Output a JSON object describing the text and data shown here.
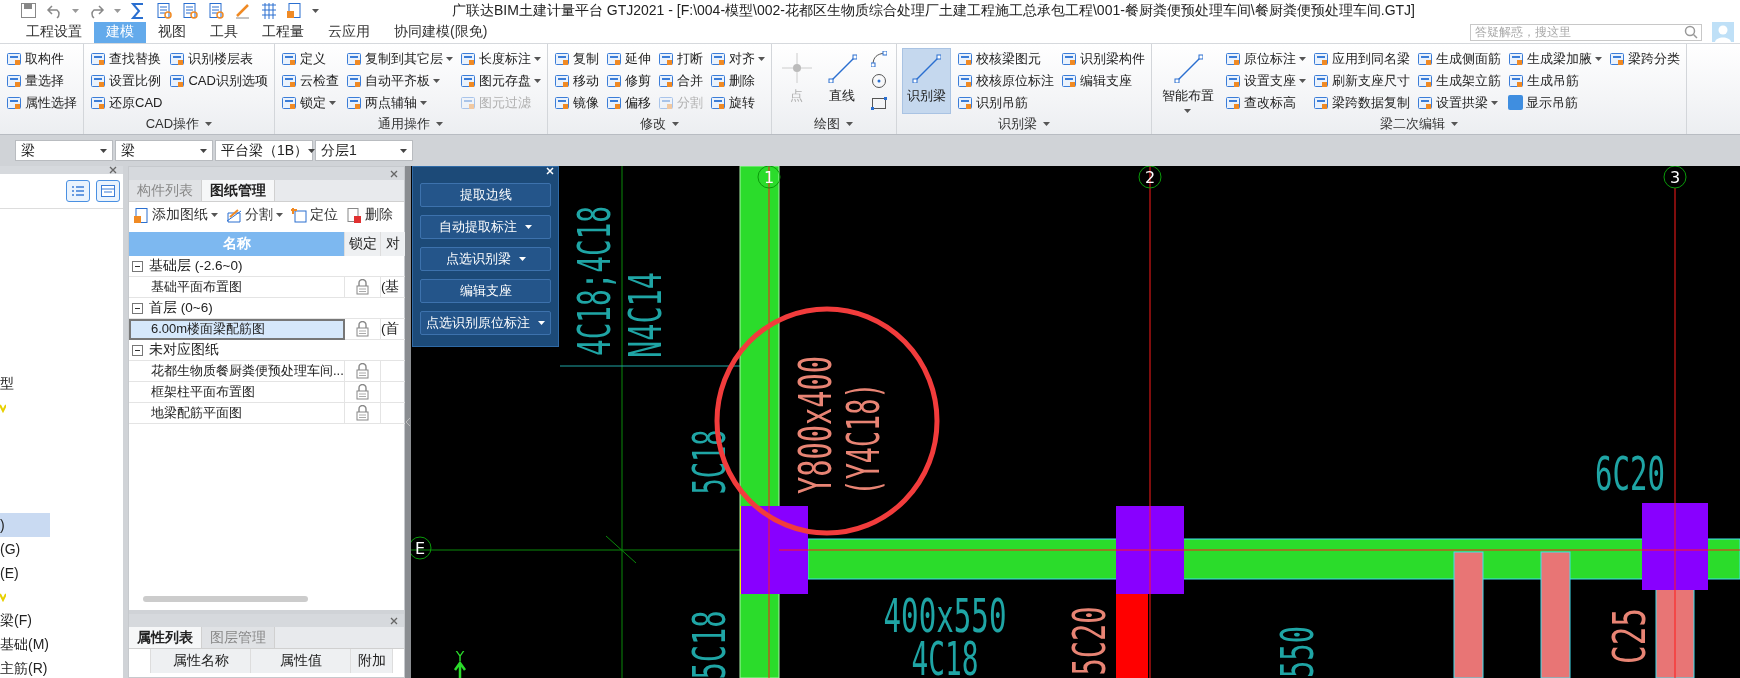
{
  "window": {
    "title": "广联达BIM土建计量平台 GTJ2021 - [F:\\004-模型\\002-花都区生物质综合处理厂土建工程施工总承包工程\\001-餐厨粪便预处理车间\\餐厨粪便预处理车间.GTJ]"
  },
  "menu_tabs": [
    {
      "label": "工程设置",
      "selected": false
    },
    {
      "label": "建模",
      "selected": true
    },
    {
      "label": "视图",
      "selected": false
    },
    {
      "label": "工具",
      "selected": false
    },
    {
      "label": "工程量",
      "selected": false
    },
    {
      "label": "云应用",
      "selected": false
    },
    {
      "label": "协同建模(限免)",
      "selected": false
    }
  ],
  "search": {
    "placeholder": "答疑解惑，搜这里"
  },
  "ribbon_groups": [
    {
      "items": [
        {
          "label": "取构件",
          "kind": "small",
          "dropdown": false,
          "disabled": false,
          "active": false
        },
        {
          "label": "量选择",
          "kind": "small",
          "dropdown": false,
          "disabled": false,
          "active": false
        },
        {
          "label": "属性选择",
          "kind": "small",
          "dropdown": false,
          "disabled": false,
          "active": false
        }
      ]
    },
    {
      "label": "CAD操作",
      "items": [
        {
          "label": "查找替换",
          "kind": "small",
          "dropdown": false,
          "disabled": false,
          "active": false
        },
        {
          "label": "设置比例",
          "kind": "small",
          "dropdown": false,
          "disabled": false,
          "active": false
        },
        {
          "label": "还原CAD",
          "kind": "small",
          "dropdown": false,
          "disabled": false,
          "active": false
        },
        {
          "label": "识别楼层表",
          "kind": "small",
          "dropdown": false,
          "disabled": false,
          "active": false
        },
        {
          "label": "CAD识别选项",
          "kind": "small",
          "dropdown": false,
          "disabled": false,
          "active": false
        }
      ]
    },
    {
      "label": "通用操作",
      "items": [
        {
          "label": "定义",
          "kind": "small",
          "dropdown": false,
          "disabled": false,
          "active": false
        },
        {
          "label": "云检查",
          "kind": "small",
          "dropdown": false,
          "disabled": false,
          "active": false
        },
        {
          "label": "锁定",
          "kind": "small",
          "dropdown": true,
          "disabled": false,
          "active": false
        },
        {
          "label": "复制到其它层",
          "kind": "small",
          "dropdown": true,
          "disabled": false,
          "active": false
        },
        {
          "label": "自动平齐板",
          "kind": "small",
          "dropdown": true,
          "disabled": false,
          "active": false
        },
        {
          "label": "两点辅轴",
          "kind": "small",
          "dropdown": true,
          "disabled": false,
          "active": false
        },
        {
          "label": "长度标注",
          "kind": "small",
          "dropdown": true,
          "disabled": false,
          "active": false
        },
        {
          "label": "图元存盘",
          "kind": "small",
          "dropdown": true,
          "disabled": false,
          "active": false
        },
        {
          "label": "图元过滤",
          "kind": "small",
          "dropdown": false,
          "disabled": true,
          "active": false
        }
      ]
    },
    {
      "label": "修改",
      "items": [
        {
          "label": "复制",
          "kind": "small",
          "dropdown": false,
          "disabled": false,
          "active": false
        },
        {
          "label": "移动",
          "kind": "small",
          "dropdown": false,
          "disabled": false,
          "active": false
        },
        {
          "label": "镜像",
          "kind": "small",
          "dropdown": false,
          "disabled": false,
          "active": false
        },
        {
          "label": "延伸",
          "kind": "small",
          "dropdown": false,
          "disabled": false,
          "active": false
        },
        {
          "label": "修剪",
          "kind": "small",
          "dropdown": false,
          "disabled": false,
          "active": false
        },
        {
          "label": "偏移",
          "kind": "small",
          "dropdown": false,
          "disabled": false,
          "active": false
        },
        {
          "label": "打断",
          "kind": "small",
          "dropdown": false,
          "disabled": false,
          "active": false
        },
        {
          "label": "合并",
          "kind": "small",
          "dropdown": false,
          "disabled": false,
          "active": false
        },
        {
          "label": "分割",
          "kind": "small",
          "dropdown": false,
          "disabled": true,
          "active": false
        },
        {
          "label": "对齐",
          "kind": "small",
          "dropdown": true,
          "disabled": false,
          "active": false
        },
        {
          "label": "删除",
          "kind": "small",
          "dropdown": false,
          "disabled": false,
          "active": false
        },
        {
          "label": "旋转",
          "kind": "small",
          "dropdown": false,
          "disabled": false,
          "active": false
        }
      ]
    },
    {
      "label": "绘图",
      "items": [
        {
          "label": "点",
          "kind": "large",
          "dropdown": false,
          "disabled": true,
          "active": false
        },
        {
          "label": "直线",
          "kind": "large",
          "dropdown": false,
          "disabled": false,
          "active": false
        },
        {
          "kind": "icon",
          "dropdown": false,
          "disabled": false,
          "active": false
        },
        {
          "kind": "icon",
          "dropdown": false,
          "disabled": false,
          "active": false
        },
        {
          "kind": "icon",
          "dropdown": false,
          "disabled": false,
          "active": false
        }
      ]
    },
    {
      "label": "识别梁",
      "items": [
        {
          "label": "识别梁",
          "kind": "large",
          "dropdown": false,
          "disabled": false,
          "active": true
        },
        {
          "label": "校核梁图元",
          "kind": "small",
          "dropdown": false,
          "disabled": false,
          "active": false
        },
        {
          "label": "校核原位标注",
          "kind": "small",
          "dropdown": false,
          "disabled": false,
          "active": false
        },
        {
          "label": "识别吊筋",
          "kind": "small",
          "dropdown": false,
          "disabled": false,
          "active": false
        },
        {
          "label": "识别梁构件",
          "kind": "small",
          "dropdown": false,
          "disabled": false,
          "active": false
        },
        {
          "label": "编辑支座",
          "kind": "small",
          "dropdown": false,
          "disabled": false,
          "active": false
        }
      ]
    },
    {
      "label": "梁二次编辑",
      "items": [
        {
          "label": "智能布置",
          "kind": "large",
          "dropdown": true,
          "disabled": false,
          "active": false
        },
        {
          "label": "原位标注",
          "kind": "small",
          "dropdown": true,
          "disabled": false,
          "active": false
        },
        {
          "label": "设置支座",
          "kind": "small",
          "dropdown": true,
          "disabled": false,
          "active": false
        },
        {
          "label": "查改标高",
          "kind": "small",
          "dropdown": false,
          "disabled": false,
          "active": false
        },
        {
          "label": "应用到同名梁",
          "kind": "small",
          "dropdown": false,
          "disabled": false,
          "active": false
        },
        {
          "label": "刷新支座尺寸",
          "kind": "small",
          "dropdown": false,
          "disabled": false,
          "active": false
        },
        {
          "label": "梁跨数据复制",
          "kind": "small",
          "dropdown": false,
          "disabled": false,
          "active": false
        },
        {
          "label": "生成侧面筋",
          "kind": "small",
          "dropdown": false,
          "disabled": false,
          "active": false
        },
        {
          "label": "生成架立筋",
          "kind": "small",
          "dropdown": false,
          "disabled": false,
          "active": false
        },
        {
          "label": "设置拱梁",
          "kind": "small",
          "dropdown": true,
          "disabled": false,
          "active": false
        },
        {
          "label": "生成梁加腋",
          "kind": "small",
          "dropdown": true,
          "disabled": false,
          "active": false
        },
        {
          "label": "生成吊筋",
          "kind": "small",
          "dropdown": false,
          "disabled": false,
          "active": false
        },
        {
          "label": "显示吊筋",
          "kind": "checkbox",
          "checked": true,
          "dropdown": false,
          "disabled": false,
          "active": false
        },
        {
          "label": "梁跨分类",
          "kind": "small",
          "dropdown": false,
          "disabled": false,
          "active": false
        }
      ]
    }
  ],
  "selectors": [
    "梁",
    "梁",
    "平台梁（1B）",
    "分层1"
  ],
  "tree_panel": {
    "sections": [
      [
        {
          "kind": "text",
          "label": "型",
          "selected": false
        },
        {
          "kind": "mark",
          "selected": false
        }
      ],
      [
        {
          "kind": "text",
          "label": ")",
          "selected": true
        },
        {
          "kind": "text",
          "label": "(G)",
          "selected": false
        },
        {
          "kind": "text",
          "label": "(E)",
          "selected": false
        },
        {
          "kind": "mark",
          "selected": false
        }
      ],
      [
        {
          "kind": "text",
          "label": "梁(F)",
          "selected": false
        },
        {
          "kind": "text",
          "label": "基础(M)",
          "selected": false
        },
        {
          "kind": "text",
          "label": "主筋(R)",
          "selected": false
        }
      ]
    ]
  },
  "drawings_panel": {
    "tabs": [
      {
        "label": "构件列表",
        "selected": false
      },
      {
        "label": "图纸管理",
        "selected": true
      }
    ],
    "toolbar": [
      {
        "label": "添加图纸",
        "dropdown": true
      },
      {
        "label": "分割",
        "dropdown": true
      },
      {
        "label": "定位",
        "dropdown": false
      },
      {
        "label": "删除",
        "dropdown": false
      }
    ],
    "columns": [
      "名称",
      "锁定",
      "对"
    ],
    "groups": [
      {
        "label": "基础层 (-2.6~0)",
        "expanded": true,
        "rows": [
          {
            "name": "基础平面布置图",
            "column_3": "(基",
            "selected": false
          }
        ]
      },
      {
        "label": "首层 (0~6)",
        "expanded": true,
        "rows": [
          {
            "name": "6.00m楼面梁配筋图",
            "column_3": "(首",
            "selected": true
          }
        ]
      },
      {
        "label": "未对应图纸",
        "expanded": true,
        "rows": [
          {
            "name": "花都生物质餐厨粪便预处理车间...",
            "selected": false
          },
          {
            "name": "框架柱平面布置图",
            "selected": false
          },
          {
            "name": "地梁配筋平面图",
            "selected": false
          }
        ]
      }
    ]
  },
  "properties_panel": {
    "tabs": [
      {
        "label": "属性列表",
        "selected": true
      },
      {
        "label": "图层管理",
        "selected": false
      }
    ],
    "columns": [
      "属性名称",
      "属性值",
      "附加"
    ]
  },
  "floating_panel": {
    "buttons": [
      {
        "label": "提取边线",
        "dropdown": false
      },
      {
        "label": "自动提取标注",
        "dropdown": true
      },
      {
        "label": "点选识别梁",
        "dropdown": true
      },
      {
        "label": "编辑支座",
        "dropdown": false
      },
      {
        "label": "点选识别原位标注",
        "dropdown": true
      }
    ]
  },
  "canvas": {
    "axis_labels": [
      "1",
      "2",
      "3",
      "E"
    ],
    "ucs_label": "Y",
    "annotations": [
      {
        "text": "4C18;4C18",
        "color": "#1fa5a5"
      },
      {
        "text": "N4C14",
        "color": "#1fa5a5"
      },
      {
        "text": "5C18",
        "color": "#1fa5a5"
      },
      {
        "text": "Y800x400",
        "color": "#e88474"
      },
      {
        "text": "(Y4C18)",
        "color": "#e88474"
      },
      {
        "text": "5C18",
        "color": "#1fa5a5"
      },
      {
        "text": "400x550",
        "color": "#1fa5a5"
      },
      {
        "text": "4C18",
        "color": "#1fa5a5"
      },
      {
        "text": "5C20",
        "color": "#e88474"
      },
      {
        "text": "6C20",
        "color": "#1fa5a5"
      },
      {
        "text": "550",
        "color": "#1fa5a5"
      },
      {
        "text": "C25",
        "color": "#e88474"
      }
    ]
  }
}
